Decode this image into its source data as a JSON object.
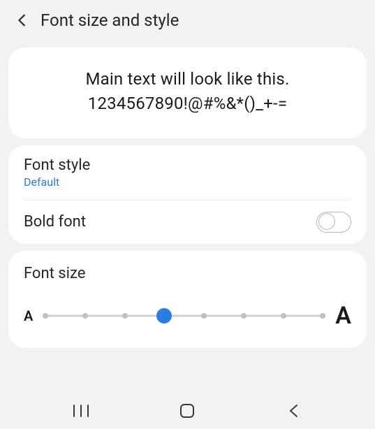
{
  "header": {
    "title": "Font size and style"
  },
  "preview": {
    "line1": "Main text will look like this.",
    "line2": "1234567890!@#%&*()_+-="
  },
  "font_style": {
    "label": "Font style",
    "value": "Default"
  },
  "bold_font": {
    "label": "Bold font",
    "enabled": false
  },
  "font_size": {
    "label": "Font size",
    "small_indicator": "A",
    "large_indicator": "A",
    "steps": 8,
    "current_index": 3
  },
  "nav": {
    "recents": "recents",
    "home": "home",
    "back": "back"
  }
}
